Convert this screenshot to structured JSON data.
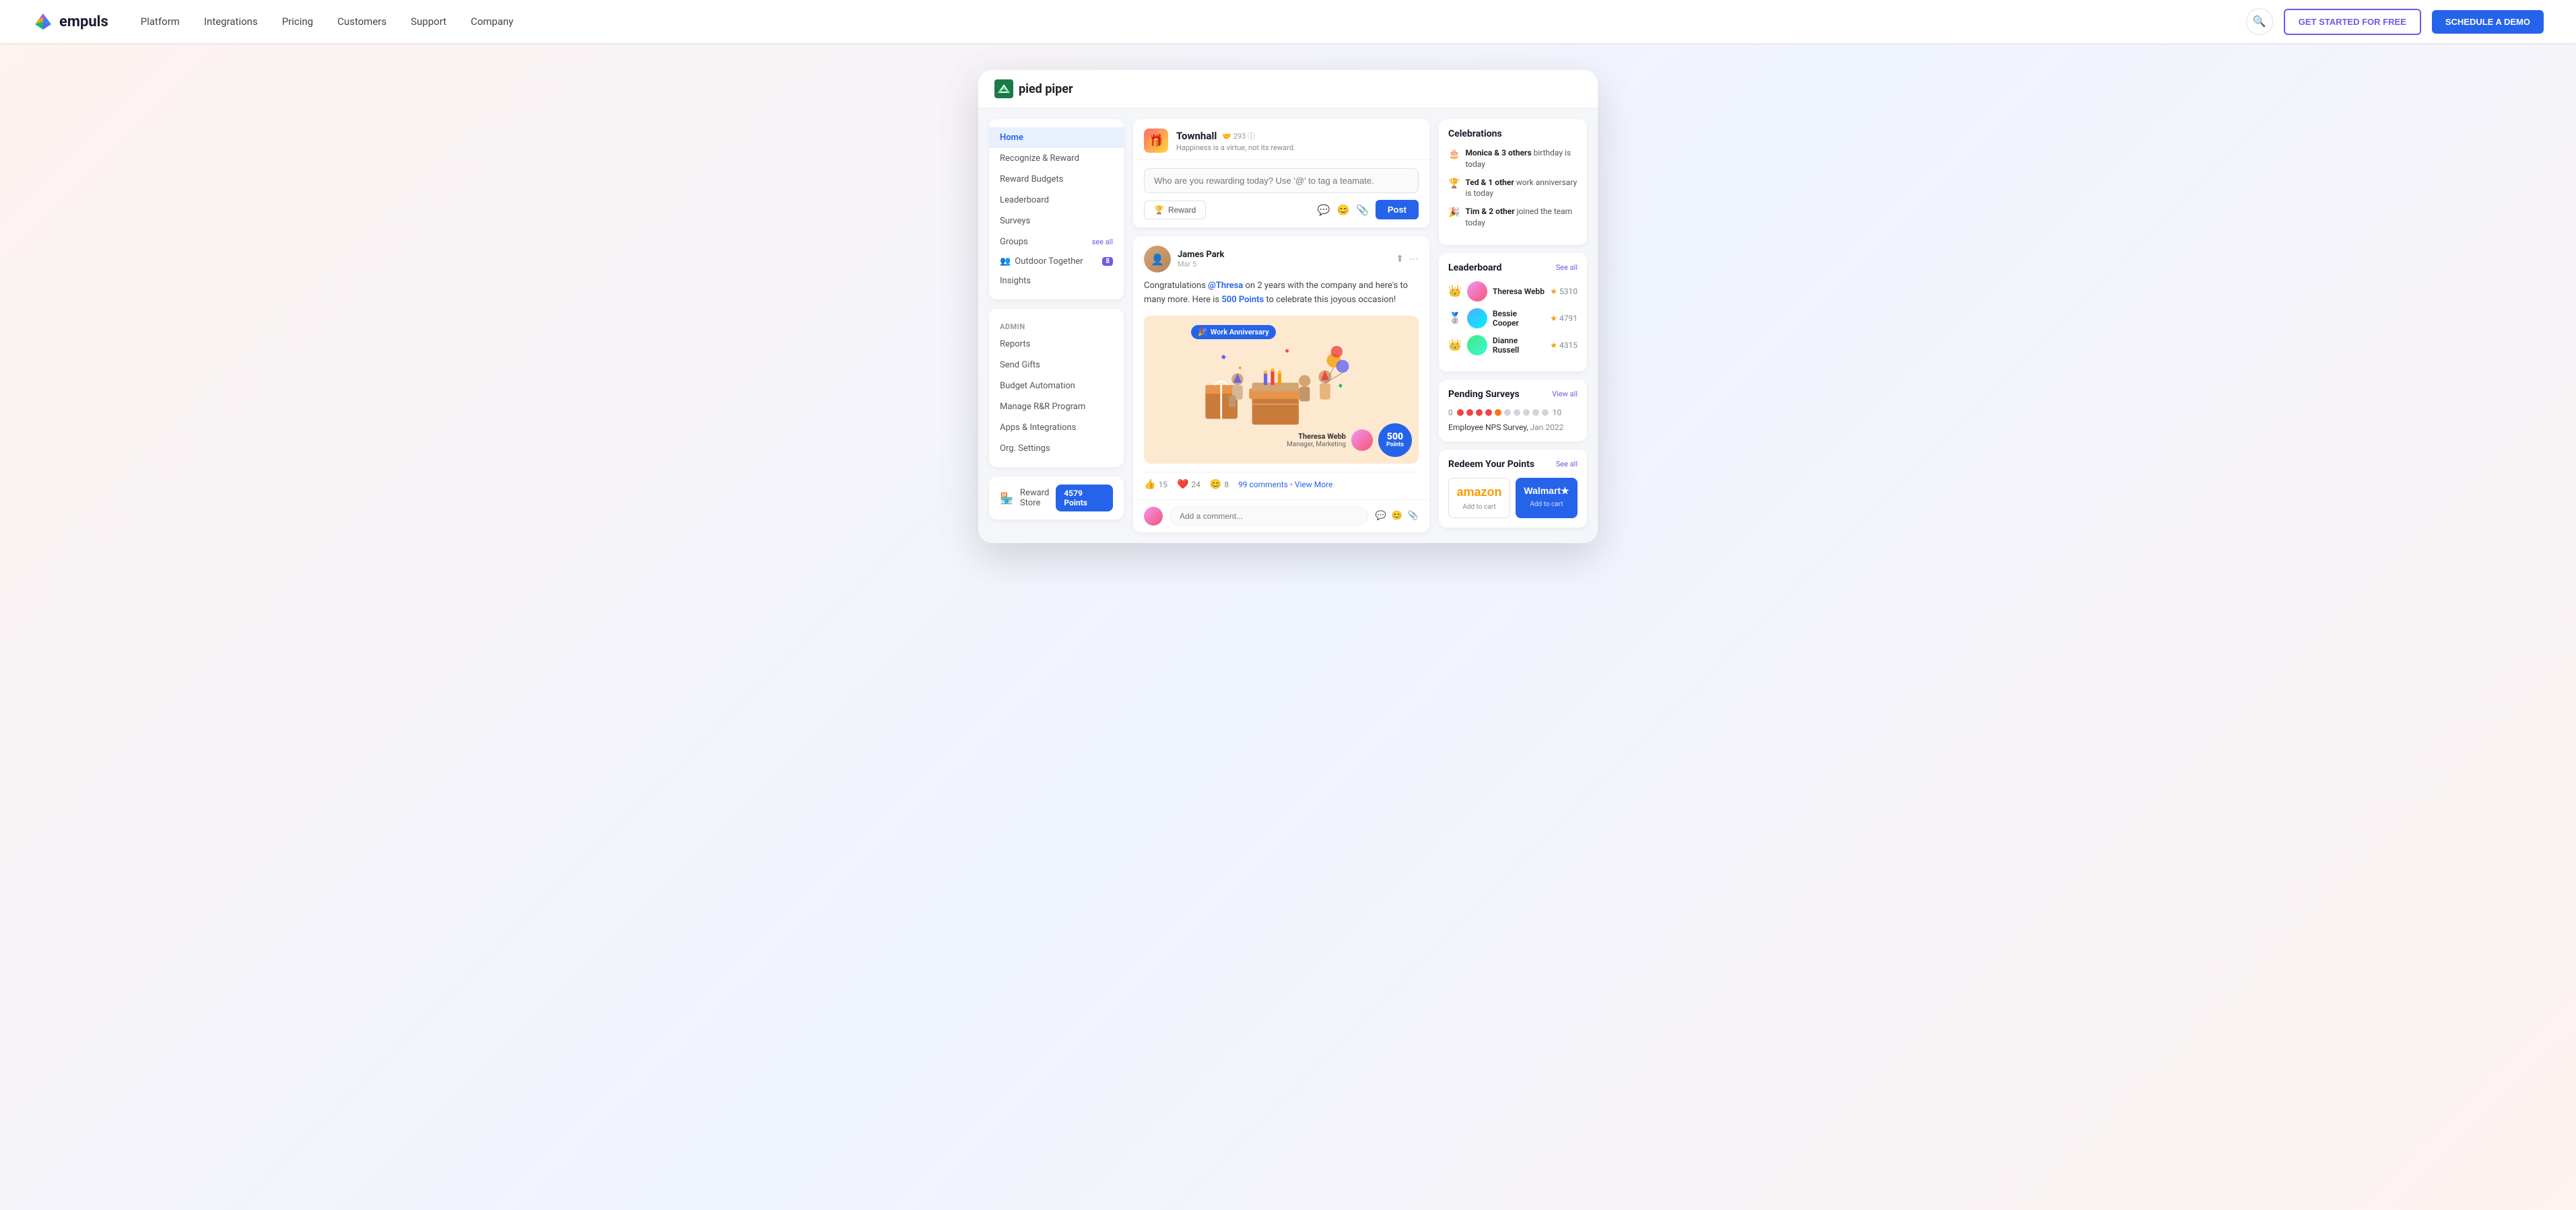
{
  "navbar": {
    "logo_text": "empuls",
    "nav_links": [
      {
        "label": "Platform",
        "id": "platform"
      },
      {
        "label": "Integrations",
        "id": "integrations"
      },
      {
        "label": "Pricing",
        "id": "pricing"
      },
      {
        "label": "Customers",
        "id": "customers"
      },
      {
        "label": "Support",
        "id": "support"
      },
      {
        "label": "Company",
        "id": "company"
      }
    ],
    "cta_free": "GET STARTED FOR FREE",
    "cta_demo": "SCHEDULE A DEMO"
  },
  "app": {
    "company_name": "pied piper",
    "sidebar": {
      "main_items": [
        {
          "label": "Home",
          "active": true
        },
        {
          "label": "Recognize & Reward",
          "active": false
        },
        {
          "label": "Reward Budgets",
          "active": false
        },
        {
          "label": "Leaderboard",
          "active": false
        },
        {
          "label": "Surveys",
          "active": false
        }
      ],
      "groups_label": "Groups",
      "see_all": "see all",
      "groups": [
        {
          "icon": "👥",
          "label": "Outdoor Together",
          "badge": "8"
        }
      ],
      "insights": "Insights",
      "admin_section": "ADMIN",
      "admin_items": [
        "Reports",
        "Send Gifts",
        "Budget Automation",
        "Manage R&R Program",
        "Apps & Integrations",
        "Org. Settings"
      ],
      "reward_store": "Reward Store",
      "points": "4579 Points"
    },
    "townhall": {
      "title": "Townhall",
      "member_count": "293",
      "subtitle": "Happiness is a virtue, not its reward.",
      "post_placeholder": "Who are you rewarding today? Use '@' to tag a teamate.",
      "reward_btn": "Reward",
      "post_btn": "Post"
    },
    "feed_post": {
      "author": "James Park",
      "date": "Mar 5",
      "text_pre": "Congratulations ",
      "mention": "@Thresa",
      "text_mid": " on 2 years with the company and here's to many more. Here is ",
      "points": "500 Points",
      "text_end": " to celebrate this joyous occasion!",
      "badge": "Work Anniversary",
      "poster_name": "Theresa Webb",
      "poster_title": "Manager, Marketing",
      "points_label": "Points",
      "points_value": "500",
      "reactions": [
        {
          "icon": "👍",
          "count": "15"
        },
        {
          "icon": "❤️",
          "count": "24"
        },
        {
          "icon": "😊",
          "count": "8"
        }
      ],
      "comments_text": "99 comments",
      "view_more": "View More",
      "comment_placeholder": "Add a comment..."
    },
    "celebrations": {
      "title": "Celebrations",
      "items": [
        {
          "icon": "🎂",
          "bold": "Monica & 3 others",
          "text": " birthday is today"
        },
        {
          "icon": "🏆",
          "bold": "Ted & 1 other",
          "text": " work anniversary is today"
        },
        {
          "icon": "🎉",
          "bold": "Tim & 2 other",
          "text": " joined the team today"
        }
      ]
    },
    "leaderboard": {
      "title": "Leaderboard",
      "see_all": "See all",
      "items": [
        {
          "rank": "👑",
          "name": "Theresa Webb",
          "score": "5310"
        },
        {
          "rank": "🥈",
          "name": "Bessie Cooper",
          "score": "4791"
        },
        {
          "rank": "👑",
          "name": "Dianne Russell",
          "score": "4315"
        }
      ]
    },
    "pending_surveys": {
      "title": "Pending Surveys",
      "view_all": "View all",
      "rating_start": "0",
      "rating_end": "10",
      "dots": [
        {
          "color": "#ef4444"
        },
        {
          "color": "#ef4444"
        },
        {
          "color": "#ef4444"
        },
        {
          "color": "#ef4444"
        },
        {
          "color": "#f97316"
        },
        {
          "color": "#d1d5db"
        },
        {
          "color": "#d1d5db"
        },
        {
          "color": "#d1d5db"
        },
        {
          "color": "#d1d5db"
        },
        {
          "color": "#d1d5db"
        }
      ],
      "survey_name": "Employee NPS Survey",
      "survey_date": "Jan 2022"
    },
    "redeem": {
      "title": "Redeem Your Points",
      "see_all": "See all",
      "items": [
        {
          "logo": "amazon",
          "label": "amazon",
          "cta": "Add to cart",
          "active": false
        },
        {
          "logo": "walmart",
          "label": "Walmart★",
          "cta": "Add to cart",
          "active": true
        }
      ]
    }
  }
}
